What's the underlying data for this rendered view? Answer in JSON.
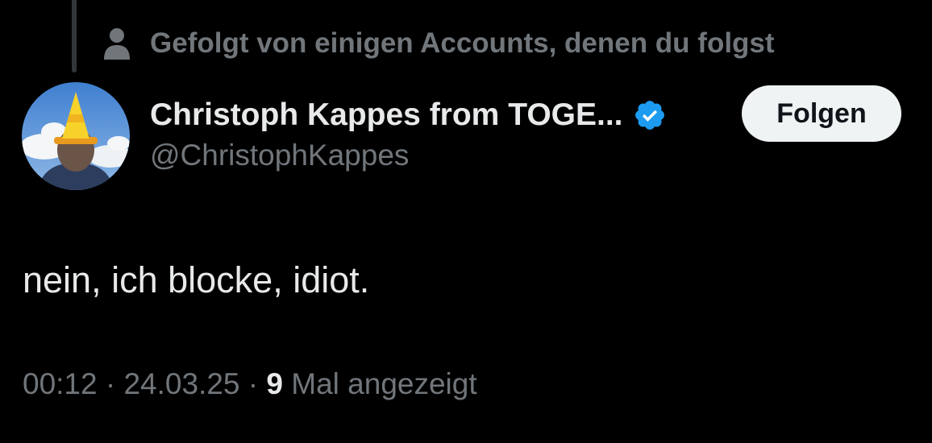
{
  "social_context": {
    "text": "Gefolgt von einigen Accounts, denen du folgst",
    "icon": "person-icon"
  },
  "author": {
    "display_name": "Christoph Kappes from TOGE...",
    "handle": "@ChristophKappes",
    "verified": true,
    "verified_color": "#1d9bf0",
    "avatar_icon": "profile-photo"
  },
  "follow_button": {
    "label": "Folgen"
  },
  "tweet": {
    "text": "nein, ich blocke, idiot."
  },
  "meta": {
    "time": "00:12",
    "separator": "·",
    "date": "24.03.25",
    "views_count": "9",
    "views_label": "Mal angezeigt"
  },
  "colors": {
    "background": "#000000",
    "primary_text": "#e7e9ea",
    "secondary_text": "#71767b",
    "button_bg": "#eff3f4",
    "button_text": "#0f1419"
  }
}
